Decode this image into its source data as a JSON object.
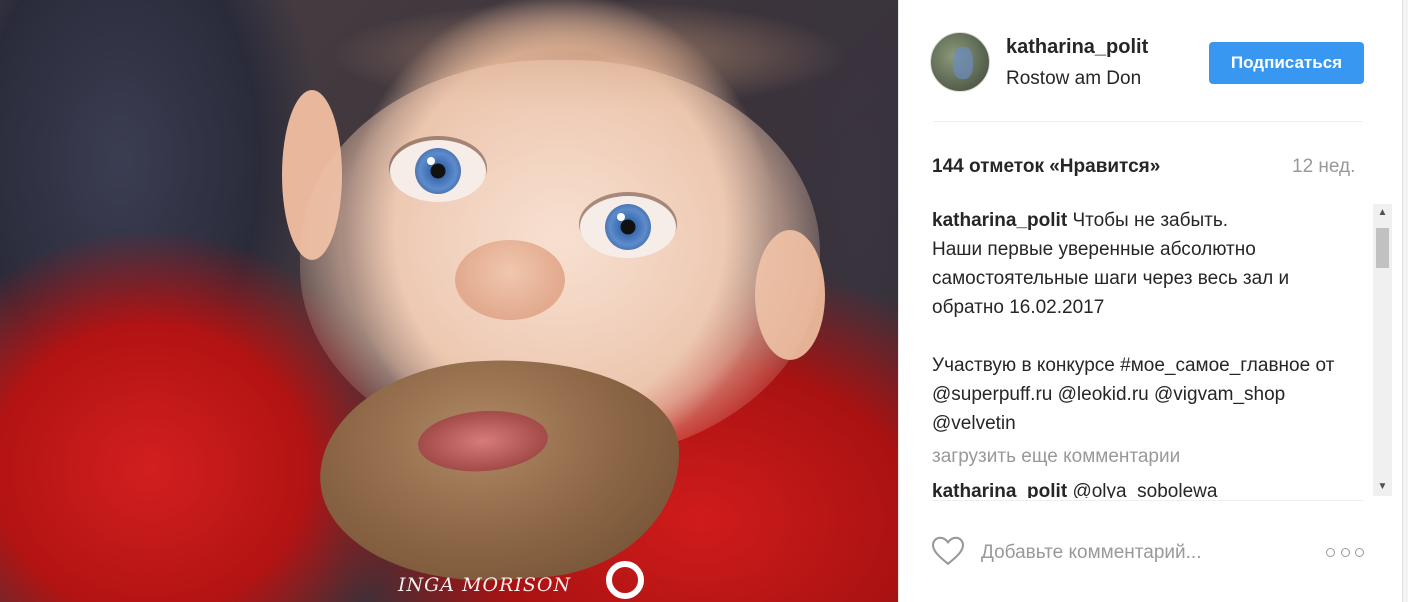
{
  "photo": {
    "watermark": "INGA MORISON",
    "alt": ""
  },
  "post": {
    "username": "katharina_polit",
    "location": "Rostow am Don",
    "follow_label": "Подписаться",
    "likes": "144 отметок «Нравится»",
    "time": "12 нед.",
    "caption": {
      "author": "katharina_polit",
      "text": "Чтобы не забыть.\nНаши первые уверенные абсолютно самостоятельные шаги через весь зал и обратно 16.02.2017",
      "text2": "Участвую в конкурсе #мое_самое_главное от @superpuff.ru @leokid.ru @vigvam_shop @velvetin"
    },
    "load_more": "загрузить еще комментарии",
    "comment": {
      "author": "katharina_polit",
      "text": "@olya_sobolewa"
    },
    "add_comment_placeholder": "Добавьте комментарий...",
    "icons": {
      "like": "heart-outline-icon",
      "more": "more-options-icon"
    },
    "colors": {
      "follow_button": "#3897f0",
      "muted_text": "#999999",
      "text": "#262626"
    }
  }
}
